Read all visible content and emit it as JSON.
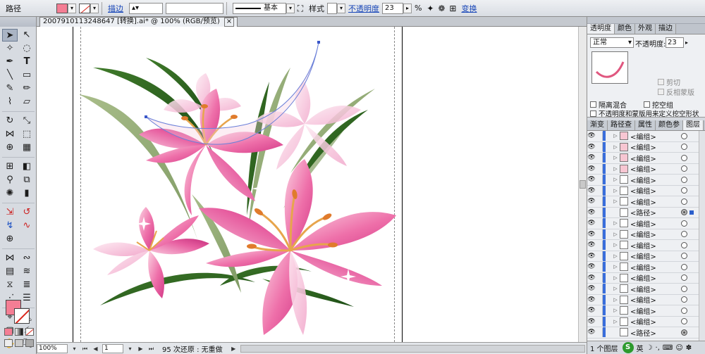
{
  "control_bar": {
    "object_type": "路径",
    "stroke_label": "描边",
    "brush_style": "基本",
    "style_label": "样式",
    "opacity_label": "不透明度",
    "opacity_value": "23",
    "percent_sign": "%",
    "transform_label": "变换",
    "fill_color": "#f47e94"
  },
  "document": {
    "tab_title": "2007910113248647 [转换].ai* @ 100% (RGB/预览)",
    "tab_close": "×"
  },
  "status_bar": {
    "zoom": "100%",
    "page": "1",
    "message": "95 次还原 : 无重做"
  },
  "transparency_panel": {
    "tabs": [
      "透明度",
      "颜色",
      "外观",
      "描边"
    ],
    "blend_mode": "正常",
    "opacity_label": "不透明度:",
    "opacity_value": "23",
    "clip_label": "剪切",
    "invert_mask_label": "反相蒙版",
    "isolate_blend_label": "隔离混合",
    "knockout_group_label": "挖空组",
    "opacity_mask_label": "不透明度和蒙版用来定义挖空形状"
  },
  "layers_panel": {
    "tabs": [
      "渐变",
      "路径查",
      "属性",
      "颜色参",
      "图层"
    ],
    "rows": [
      {
        "name": "<编组>",
        "thumb": "pink",
        "target": "empty"
      },
      {
        "name": "<编组>",
        "thumb": "pink",
        "target": "empty"
      },
      {
        "name": "<编组>",
        "thumb": "pink",
        "target": "empty"
      },
      {
        "name": "<编组>",
        "thumb": "pink",
        "target": "empty"
      },
      {
        "name": "<编组>",
        "thumb": "plain",
        "target": "empty"
      },
      {
        "name": "<编组>",
        "thumb": "plain",
        "target": "empty"
      },
      {
        "name": "<编组>",
        "thumb": "plain",
        "target": "empty"
      },
      {
        "name": "<路径>",
        "thumb": "plain",
        "target": "filled",
        "selected": true
      },
      {
        "name": "<编组>",
        "thumb": "plain",
        "target": "empty"
      },
      {
        "name": "<编组>",
        "thumb": "plain",
        "target": "empty"
      },
      {
        "name": "<编组>",
        "thumb": "plain",
        "target": "empty"
      },
      {
        "name": "<编组>",
        "thumb": "plain",
        "target": "empty"
      },
      {
        "name": "<编组>",
        "thumb": "plain",
        "target": "empty"
      },
      {
        "name": "<编组>",
        "thumb": "plain",
        "target": "empty"
      },
      {
        "name": "<编组>",
        "thumb": "plain",
        "target": "empty"
      },
      {
        "name": "<编组>",
        "thumb": "plain",
        "target": "empty"
      },
      {
        "name": "<编组>",
        "thumb": "plain",
        "target": "empty"
      },
      {
        "name": "<编组>",
        "thumb": "plain",
        "target": "empty"
      },
      {
        "name": "<路径>",
        "thumb": "plain",
        "target": "filled"
      }
    ],
    "footer_text": "1 个图层",
    "ime_label": "英"
  }
}
